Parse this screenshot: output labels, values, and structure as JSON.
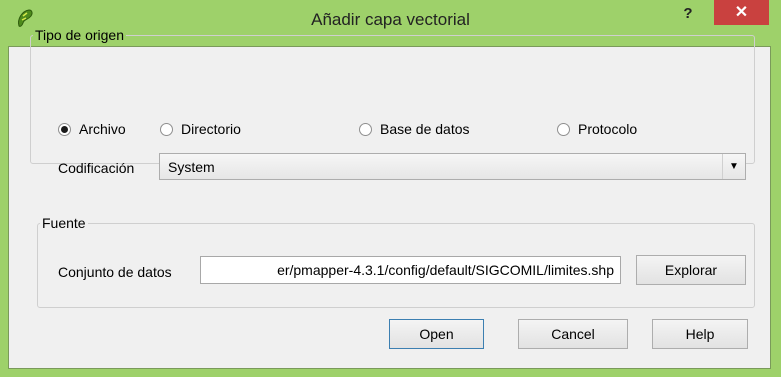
{
  "window": {
    "title": "Añadir capa vectorial",
    "help_label": "?",
    "close_label": "✕",
    "app_icon": "qgis-icon"
  },
  "source_type": {
    "legend": "Tipo de origen",
    "options": [
      {
        "label": "Archivo",
        "selected": true
      },
      {
        "label": "Directorio",
        "selected": false
      },
      {
        "label": "Base de datos",
        "selected": false
      },
      {
        "label": "Protocolo",
        "selected": false
      }
    ],
    "encoding_label": "Codificación",
    "encoding_value": "System"
  },
  "source": {
    "legend": "Fuente",
    "dataset_label": "Conjunto de datos",
    "dataset_value": "er/pmapper-4.3.1/config/default/SIGCOMIL/limites.shp",
    "browse_label": "Explorar"
  },
  "buttons": {
    "open": "Open",
    "cancel": "Cancel",
    "help": "Help"
  }
}
